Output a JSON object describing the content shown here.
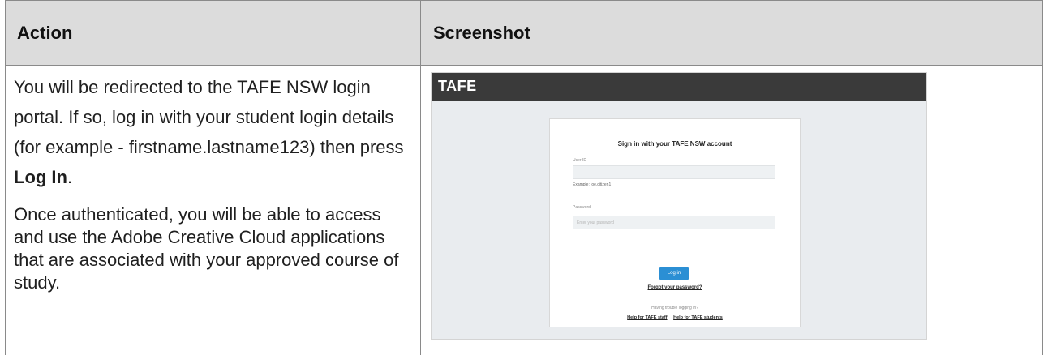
{
  "table": {
    "headers": {
      "action": "Action",
      "screenshot": "Screenshot"
    },
    "action_text": {
      "p1_before_bold": "You will be redirected to the TAFE NSW login portal. If so, log in with your student login details (for example - firstname.lastname123) then press ",
      "p1_bold": "Log In",
      "p1_after_bold": ".",
      "p2": "Once authenticated, you will be able to access and use the Adobe Creative Cloud applications that are associated with your approved course of study."
    }
  },
  "screenshot": {
    "logo": "TAFE",
    "card_title": "Sign in with your TAFE NSW account",
    "user_id_label": "User ID",
    "user_id_hint": "Example: joe.citizen1",
    "password_label": "Password",
    "password_placeholder": "Enter your password",
    "login_button": "Log in",
    "forgot_link": "Forgot your password?",
    "trouble_text": "Having trouble logging in?",
    "help_staff_link": "Help for TAFE staff",
    "help_students_link": "Help for TAFE students",
    "colors": {
      "header_bar": "#3a3a3a",
      "button": "#2b8fd4",
      "background": "#e9ecef"
    }
  }
}
